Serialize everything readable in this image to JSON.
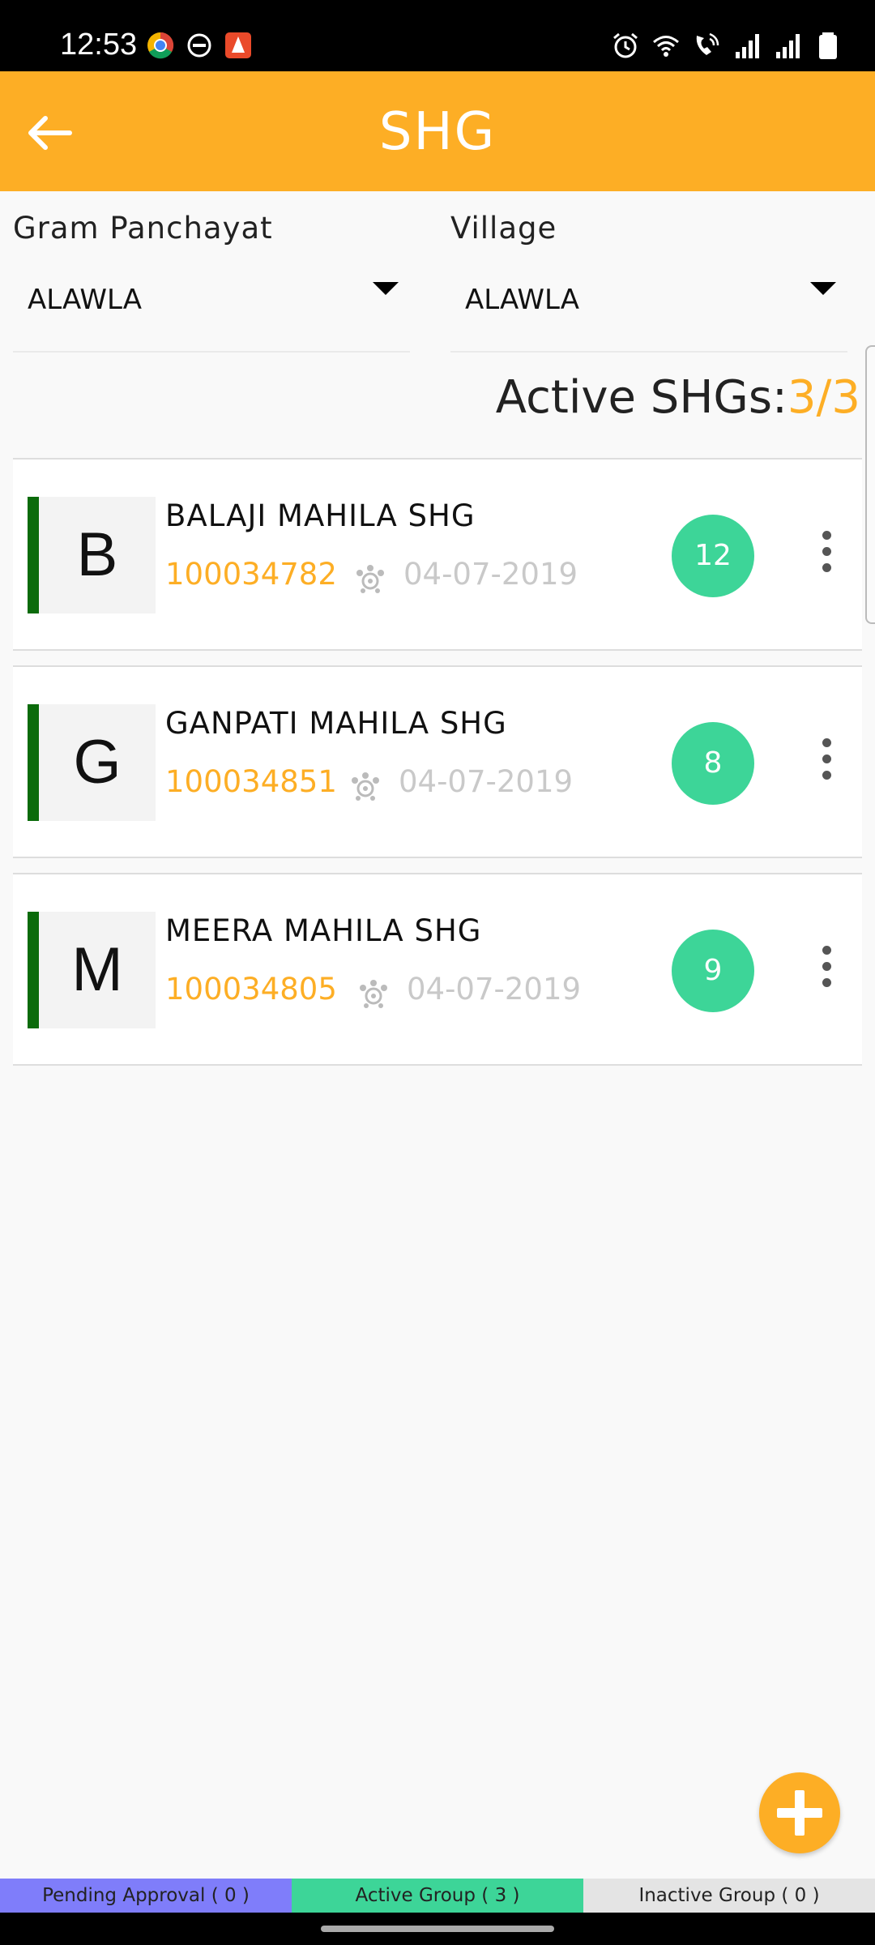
{
  "status_bar": {
    "time": "12:53",
    "left_icons": [
      "chrome-like-app-icon",
      "do-not-disturb-icon",
      "notification-app-icon"
    ],
    "right_icons": [
      "alarm-icon",
      "wifi-icon",
      "wifi-call-icon",
      "signal-icon",
      "signal-roaming-icon",
      "battery-icon"
    ]
  },
  "header": {
    "title": "SHG",
    "back_icon": "arrow-left-icon",
    "background": "#FDAE25"
  },
  "filters": {
    "gram_panchayat": {
      "label": "Gram Panchayat",
      "value": "ALAWLA"
    },
    "village": {
      "label": "Village",
      "value": "ALAWLA"
    }
  },
  "summary": {
    "label": "Active SHGs:",
    "count": "3/3"
  },
  "shgs": [
    {
      "initial": "B",
      "name": "BALAJI MAHILA SHG",
      "code": "100034782",
      "date": "04-07-2019",
      "members": "12"
    },
    {
      "initial": "G",
      "name": "GANPATI MAHILA SHG",
      "code": "100034851",
      "date": "04-07-2019",
      "members": "8"
    },
    {
      "initial": "M",
      "name": "MEERA MAHILA SHG",
      "code": "100034805",
      "date": "04-07-2019",
      "members": "9"
    }
  ],
  "fab": {
    "icon": "plus-icon"
  },
  "tabs": {
    "pending": "Pending Approval ( 0 )",
    "active": "Active Group ( 3 )",
    "inactive": "Inactive Group ( 0 )"
  },
  "colors": {
    "accent": "#FDAE25",
    "badge": "#3DD598",
    "status_bar_green": "#0b6b0b",
    "pending_tab": "#7f7dfa",
    "inactive_tab": "#e4e4e4"
  }
}
